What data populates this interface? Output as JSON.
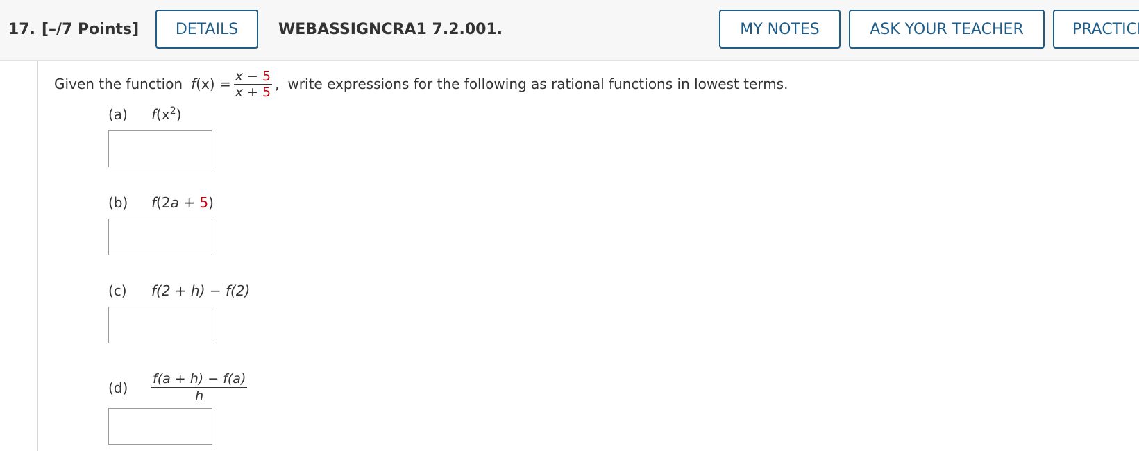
{
  "header": {
    "question_number": "17.",
    "points": "[–/7 Points]",
    "details_label": "DETAILS",
    "question_ref": "WEBASSIGNCRA1 7.2.001.",
    "my_notes_label": "MY NOTES",
    "ask_teacher_label": "ASK YOUR TEACHER",
    "practice_label": "PRACTICE ANOTHER"
  },
  "question": {
    "intro_before": "Given the function",
    "func_name": "f",
    "func_arg": "(x) =",
    "frac_num_var": "x −",
    "frac_num_const": "5",
    "frac_den_var": "x +",
    "frac_den_const": "5",
    "comma": ",",
    "intro_after": "write expressions for the following as rational functions in lowest terms.",
    "accent_color": "#c0000b"
  },
  "parts": {
    "a": {
      "label": "(a)",
      "f": "f",
      "open": "(x",
      "exp": "2",
      "close": ")",
      "value": ""
    },
    "b": {
      "label": "(b)",
      "f": "f",
      "open": "(2",
      "var": "a",
      "plus": " + ",
      "const": "5",
      "close": ")",
      "value": ""
    },
    "c": {
      "label": "(c)",
      "expr": "f(2 + h) − f(2)",
      "value": ""
    },
    "d": {
      "label": "(d)",
      "num": "f(a + h) − f(a)",
      "den": "h",
      "value": ""
    }
  }
}
